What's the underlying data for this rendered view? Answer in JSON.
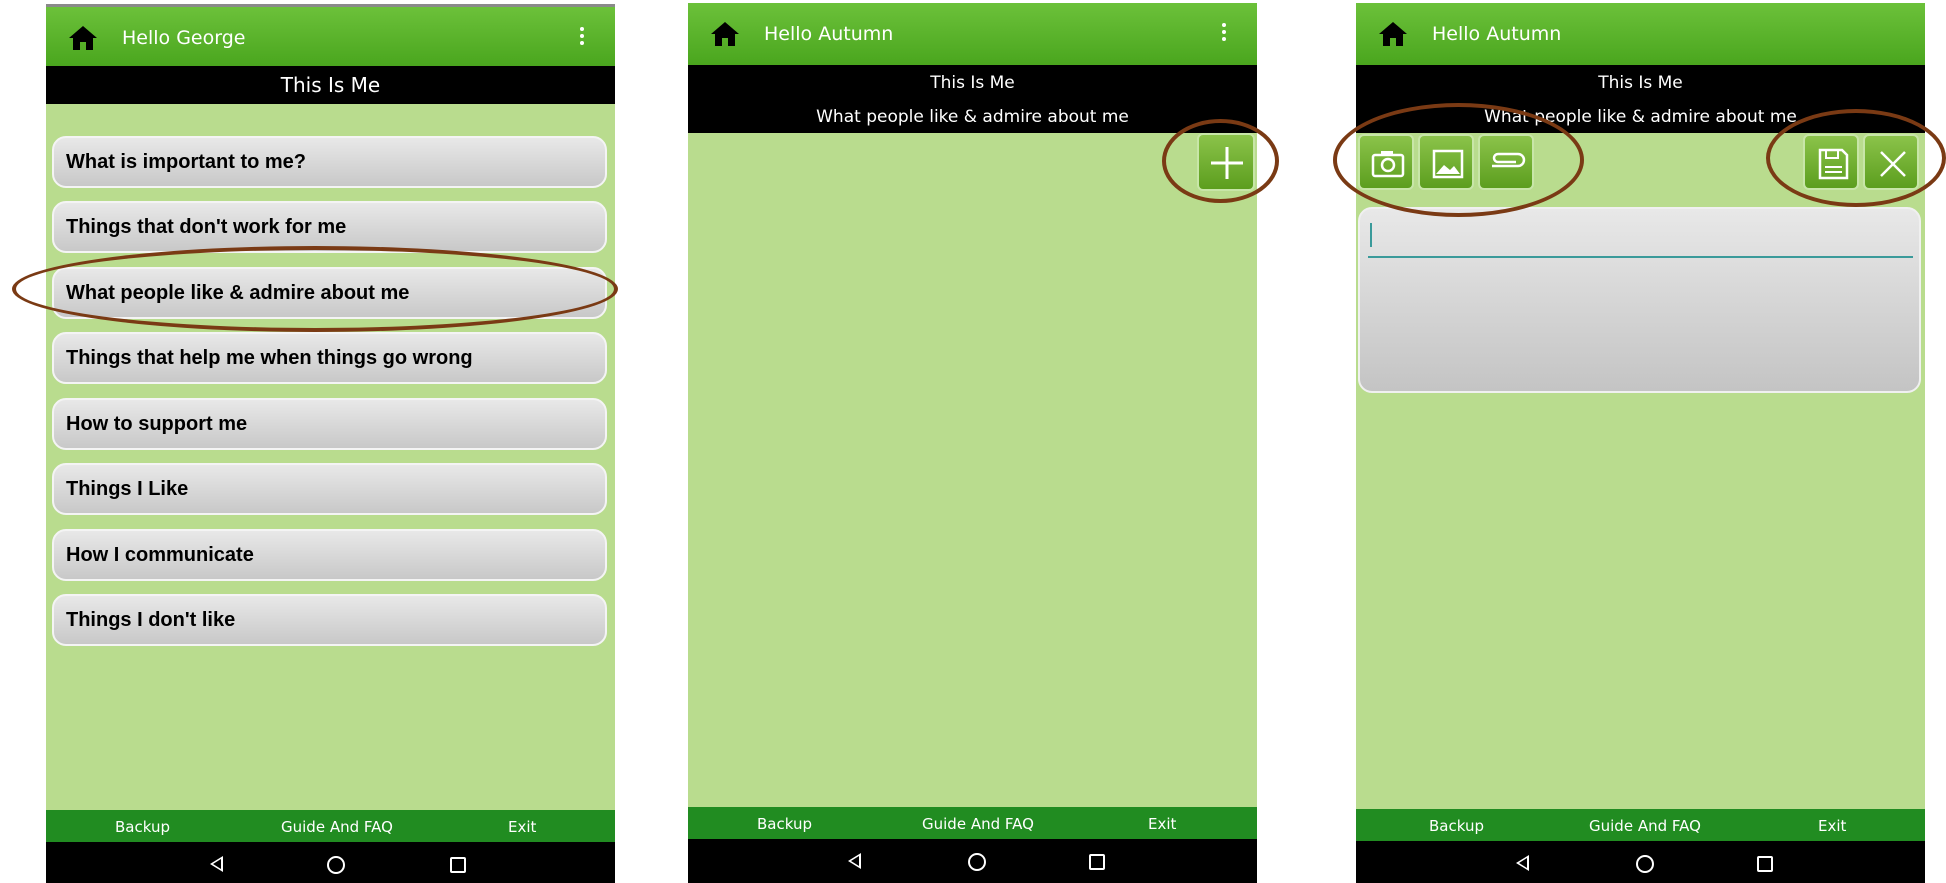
{
  "screen1": {
    "greeting": "Hello George",
    "section_title": "This Is Me",
    "items": [
      {
        "label": "What is important to me?"
      },
      {
        "label": "Things that don't work for me"
      },
      {
        "label": "What people like & admire about me"
      },
      {
        "label": "Things that help me when things go wrong"
      },
      {
        "label": "How to support me"
      },
      {
        "label": "Things I Like"
      },
      {
        "label": "How I communicate"
      },
      {
        "label": "Things I don't like"
      }
    ],
    "highlighted_item": "What people like & admire about me"
  },
  "screen2": {
    "greeting": "Hello Autumn",
    "section_title": "This Is Me",
    "subsection_title": "What people like & admire about me",
    "add_button_icon": "plus-icon"
  },
  "screen3": {
    "greeting": "Hello Autumn",
    "section_title": "This Is Me",
    "subsection_title": "What people like & admire about me",
    "attach_icons": [
      "camera-icon",
      "image-icon",
      "paperclip-icon"
    ],
    "action_icons": [
      "save-icon",
      "close-icon"
    ],
    "text_value": ""
  },
  "bottom_nav": {
    "backup": "Backup",
    "guide": "Guide And FAQ",
    "exit": "Exit"
  },
  "colors": {
    "app_bar": "#5bb52a",
    "background": "#b9dc8e",
    "bottom_nav": "#218c21",
    "annotation": "#7a3a14"
  }
}
